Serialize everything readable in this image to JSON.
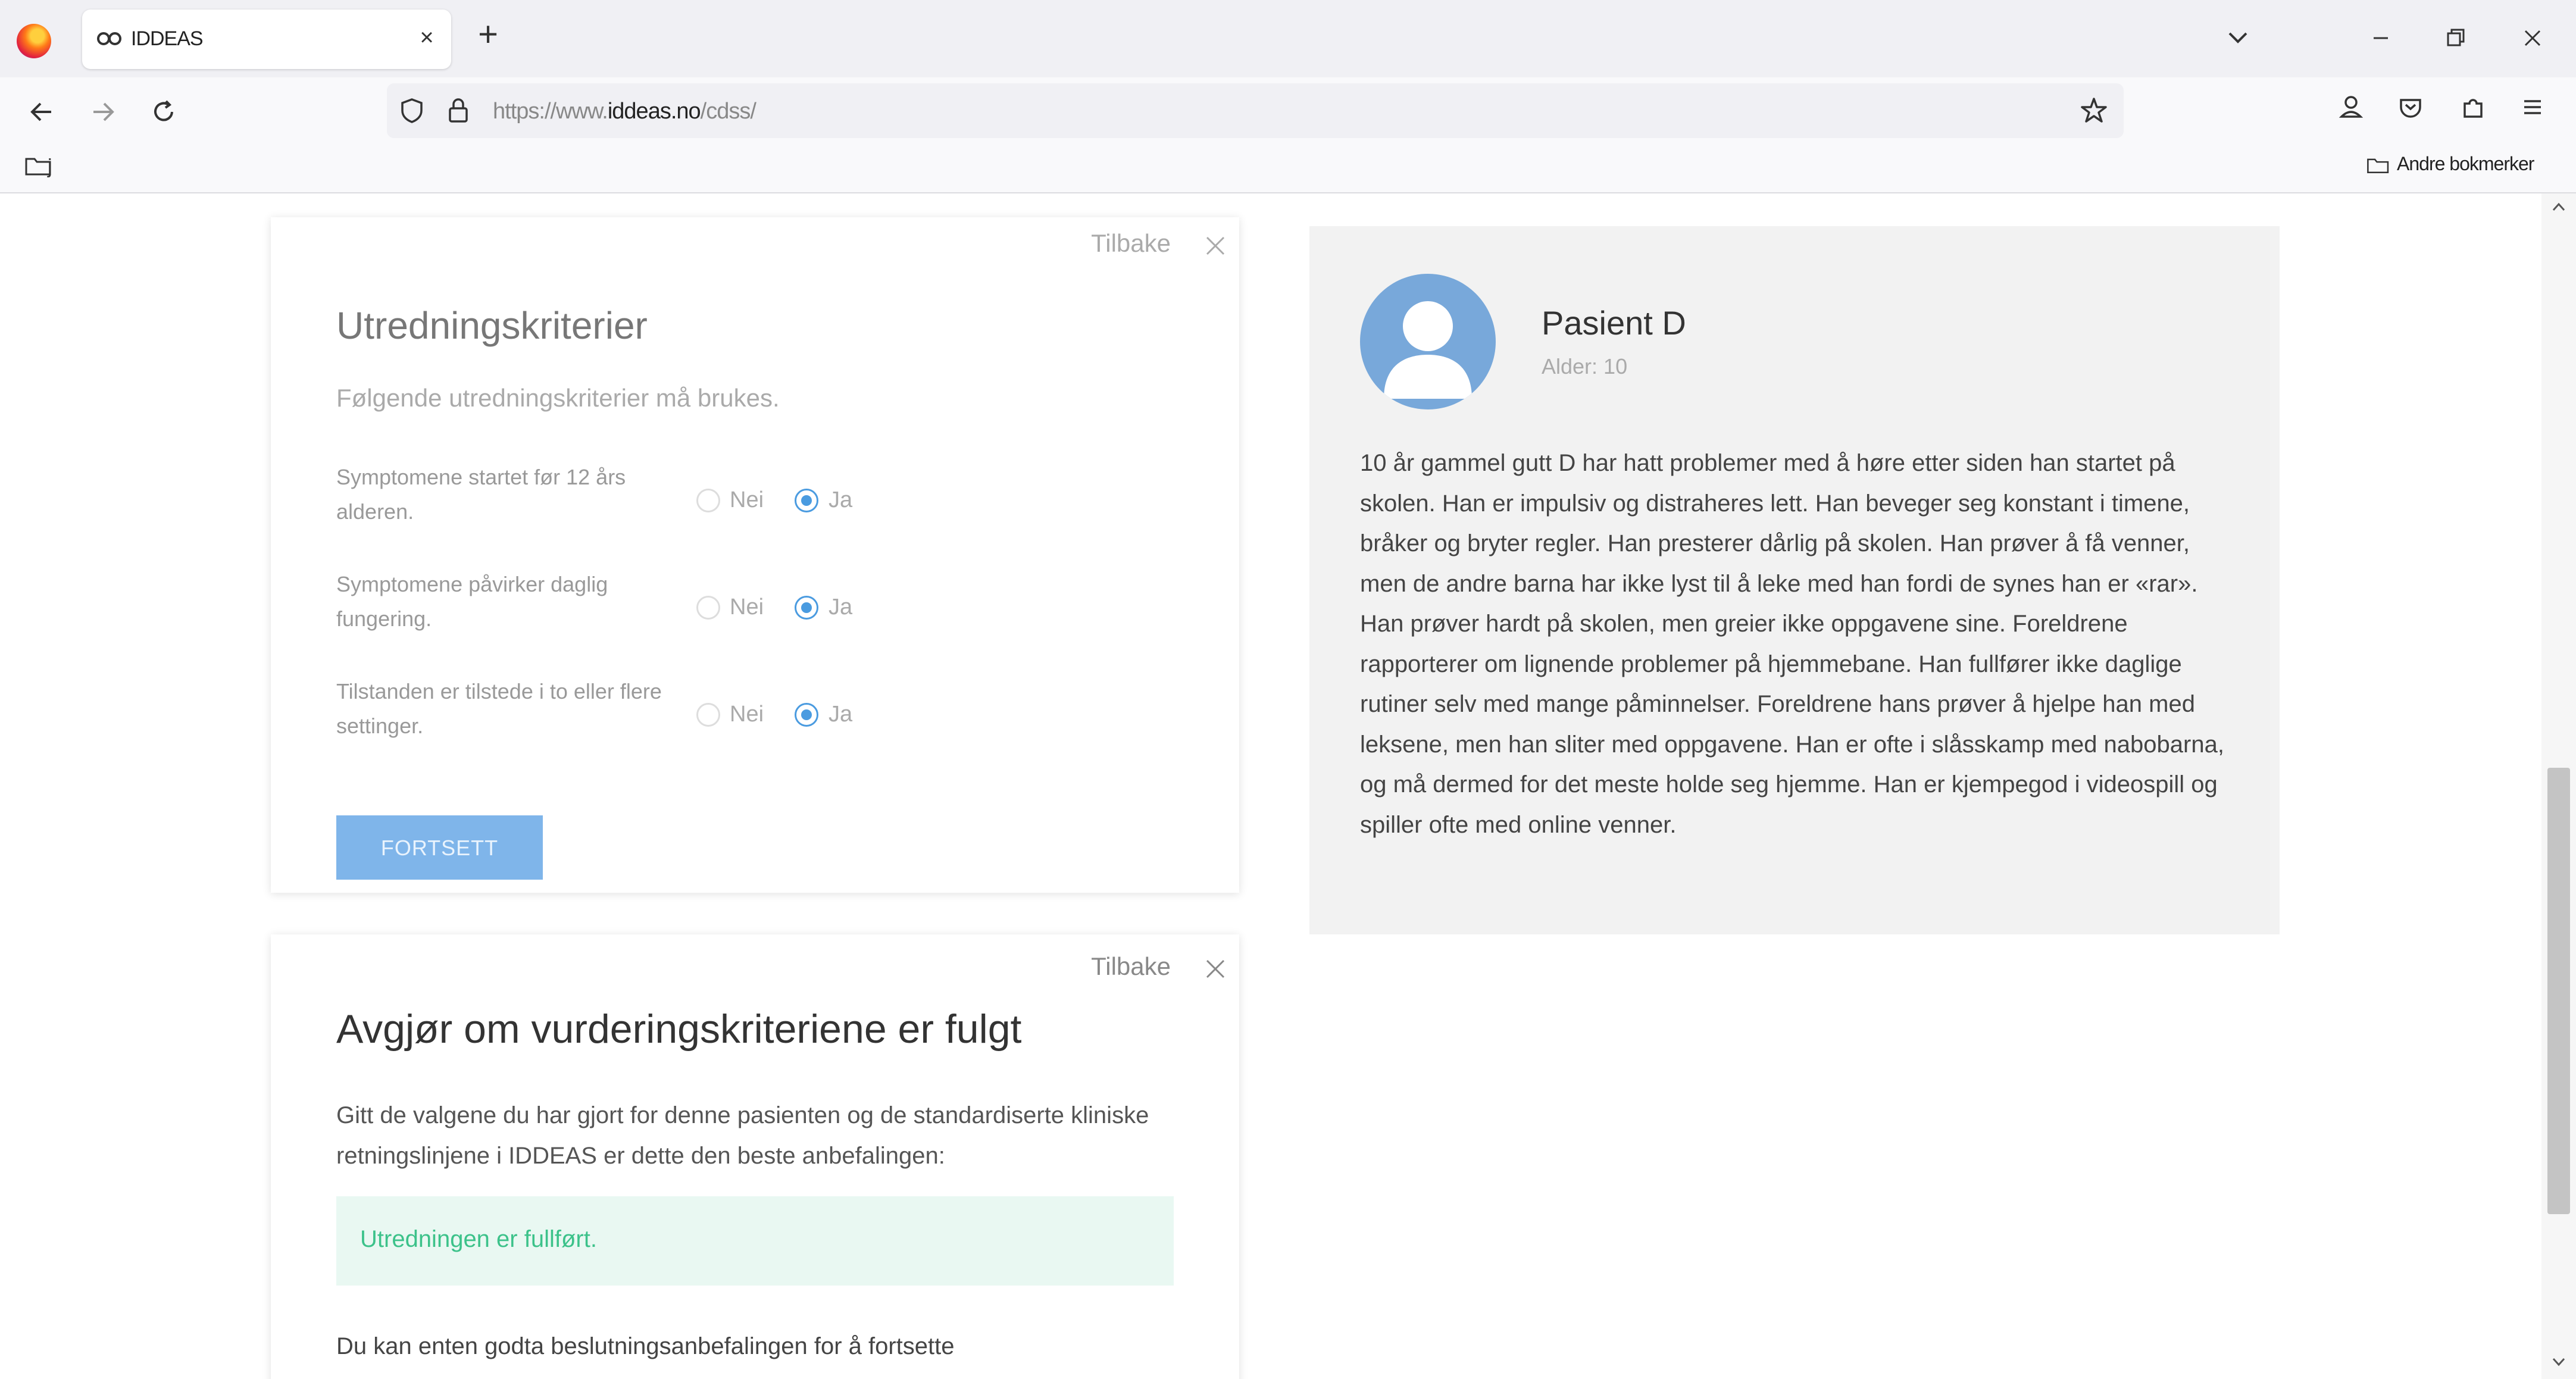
{
  "browser": {
    "tab_title": "IDDEAS",
    "url_prefix": "https://www.",
    "url_domain": "iddeas.no",
    "url_path": "/cdss/",
    "bookmark_folder": "j",
    "other_bookmarks": "Andre bokmerker"
  },
  "criteria_card": {
    "back_label": "Tilbake",
    "title": "Utredningskriterier",
    "subtitle": "Følgende utredningskriterier må brukes.",
    "criteria": [
      {
        "label": "Symptomene startet før 12 års alderen.",
        "no": "Nei",
        "yes": "Ja",
        "selected": "Ja"
      },
      {
        "label": "Symptomene påvirker daglig fungering.",
        "no": "Nei",
        "yes": "Ja",
        "selected": "Ja"
      },
      {
        "label": "Tilstanden er tilstede i to eller flere settinger.",
        "no": "Nei",
        "yes": "Ja",
        "selected": "Ja"
      }
    ],
    "continue_label": "FORTSETT"
  },
  "decision_card": {
    "back_label": "Tilbake",
    "title": "Avgjør om vurderingskriteriene er fulgt",
    "text": "Gitt de valgene du har gjort for denne pasienten og de standardiserte kliniske retningslinjene i IDDEAS er dette den beste anbefalingen:",
    "result": "Utredningen er fullført.",
    "bottom_text": "Du kan enten godta beslutningsanbefalingen for å fortsette"
  },
  "patient": {
    "name": "Pasient D",
    "age": "Alder: 10",
    "description": "10 år gammel gutt D har hatt problemer med å høre etter siden han startet på skolen. Han er impulsiv og distraheres lett. Han beveger seg konstant i timene, bråker og bryter regler. Han presterer dårlig på skolen. Han prøver å få venner, men de andre barna har ikke lyst til å leke med han fordi de synes han er «rar». Han prøver hardt på skolen, men greier ikke oppgavene sine. Foreldrene rapporterer om lignende problemer på hjemmebane. Han fullfører ikke daglige rutiner selv med mange påminnelser. Foreldrene hans prøver å hjelpe han med leksene, men han sliter med oppgavene. Han er ofte i slåsskamp med nabobarna, og må dermed for det meste holde seg hjemme. Han er kjempegod i videospill og spiller ofte med online venner."
  },
  "colors": {
    "accent": "#4a9be0",
    "button": "#7fb5ea",
    "success_bg": "#e9f8f2",
    "success_text": "#3cc28a",
    "avatar": "#78a8da"
  }
}
